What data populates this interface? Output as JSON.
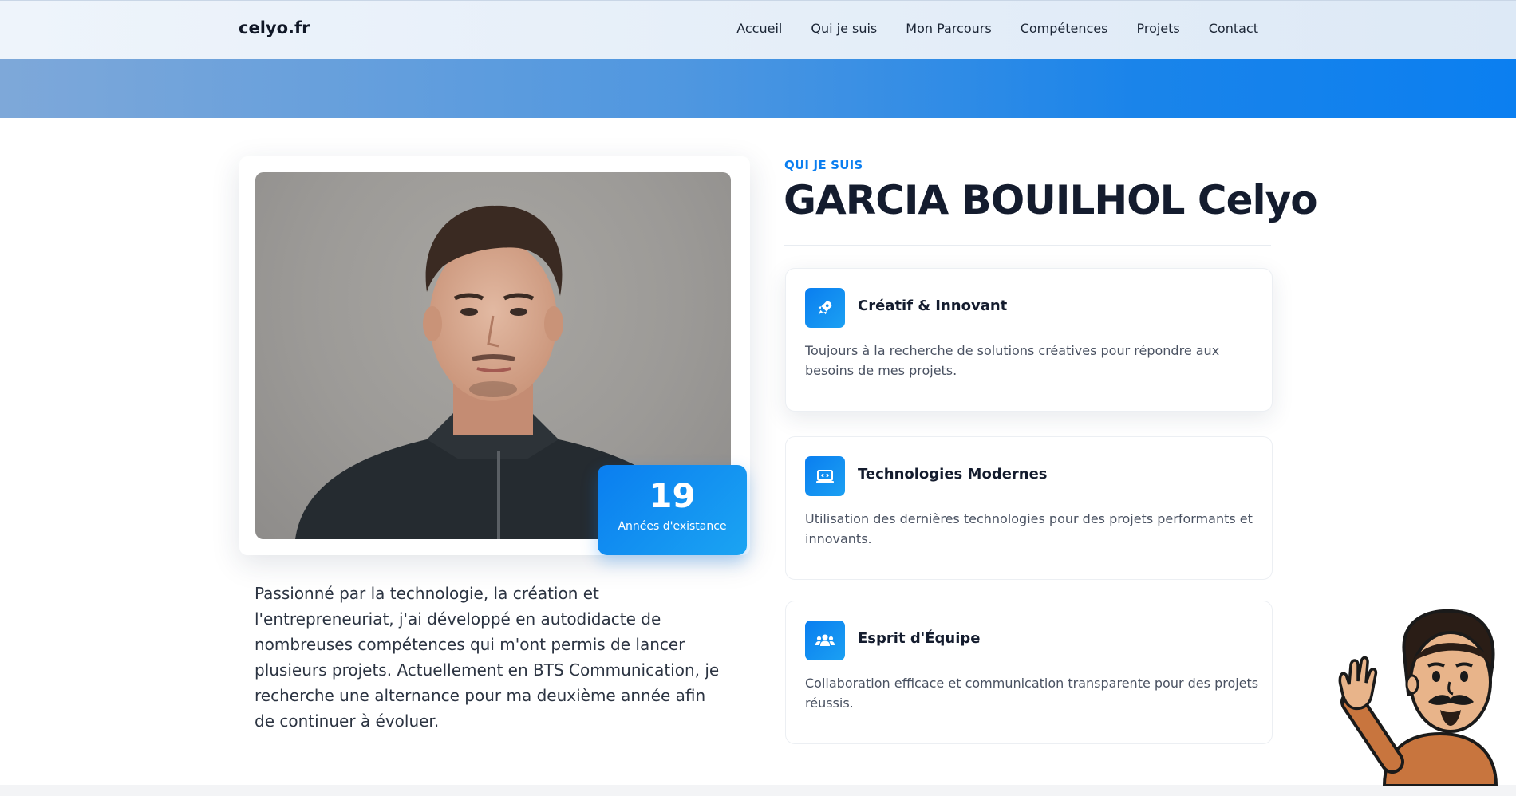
{
  "header": {
    "brand": "celyo.fr",
    "nav": [
      "Accueil",
      "Qui je suis",
      "Mon Parcours",
      "Compétences",
      "Projets",
      "Contact"
    ]
  },
  "about": {
    "eyebrow": "QUI JE SUIS",
    "name": "GARCIA BOUILHOL Celyo",
    "badge": {
      "value": "19",
      "label": "Années d'existance"
    },
    "bio": "Passionné par la technologie, la création et l'entrepreneuriat, j'ai développé en autodidacte de nombreuses compétences qui m'ont permis de lancer plusieurs projets. Actuellement en BTS Communication, je recherche une alternance pour ma deuxième année afin de continuer à évoluer.",
    "cards": [
      {
        "icon": "rocket-icon",
        "title": "Créatif & Innovant",
        "text": "Toujours à la recherche de solutions créatives pour répondre aux besoins de mes projets."
      },
      {
        "icon": "laptop-code-icon",
        "title": "Technologies Modernes",
        "text": "Utilisation des dernières technologies pour des projets performants et innovants."
      },
      {
        "icon": "users-icon",
        "title": "Esprit d'Équipe",
        "text": "Collaboration efficace et communication transparente pour des projets réussis."
      }
    ]
  },
  "colors": {
    "accent": "#0a7ef0",
    "heading": "#141c2e",
    "text": "#4a5262"
  }
}
